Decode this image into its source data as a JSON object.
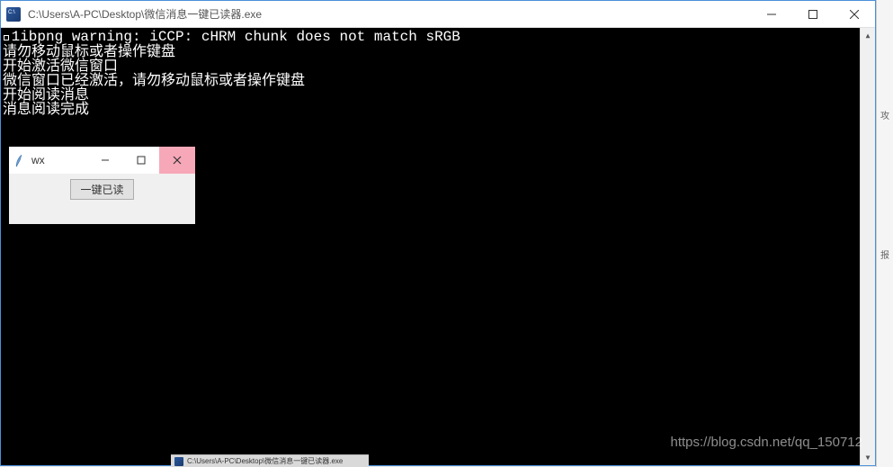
{
  "main_window": {
    "title": "C:\\Users\\A-PC\\Desktop\\微信消息一键已读器.exe"
  },
  "console": {
    "lines": [
      "\u00001ibpng warning: iCCP: cHRM chunk does not match sRGB",
      "请勿移动鼠标或者操作键盘",
      "开始激活微信窗口",
      "微信窗口已经激活，请勿移动鼠标或者操作键盘",
      "开始阅读消息",
      "消息阅读完成"
    ]
  },
  "sub_window": {
    "title": "wx",
    "button_label": "一键已读"
  },
  "watermark": "https://blog.csdn.net/qq_150712",
  "taskbar": {
    "label": "C:\\Users\\A-PC\\Desktop\\微信消息一键已读器.exe"
  },
  "right_strip": {
    "char1": "攻",
    "char2": "报"
  }
}
